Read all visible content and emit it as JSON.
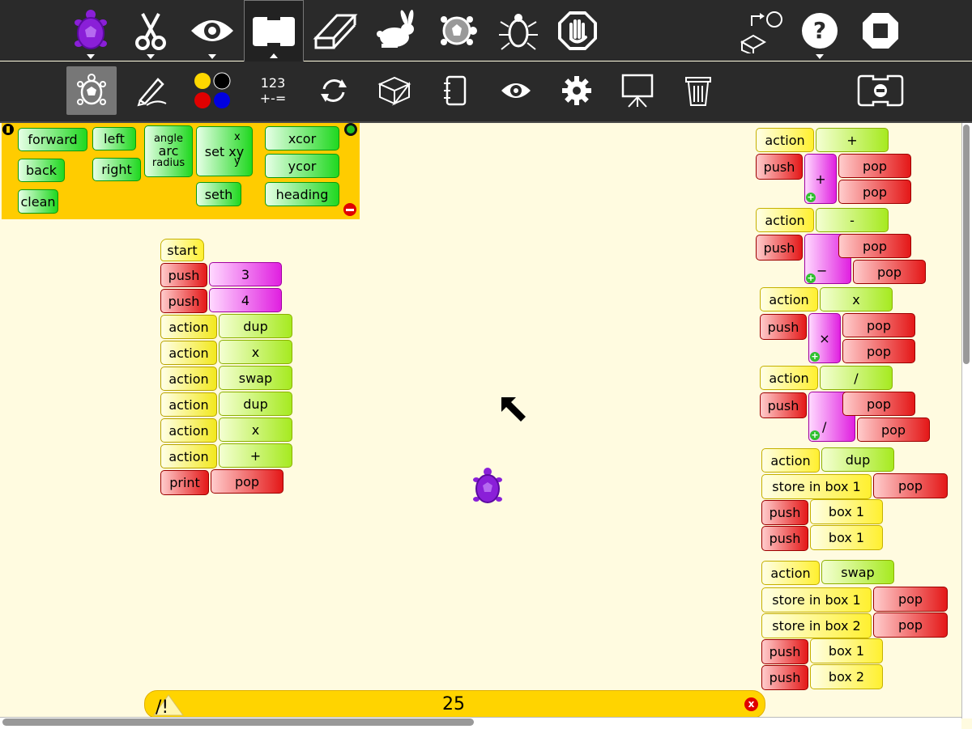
{
  "toolbar_main": {
    "items": [
      {
        "icon": "turtle-palette-icon",
        "caret": "down"
      },
      {
        "icon": "scissors-icon",
        "caret": "down"
      },
      {
        "icon": "eye-icon",
        "caret": "down"
      },
      {
        "icon": "blocks-icon",
        "caret": "up",
        "selected": true
      },
      {
        "icon": "eraser-icon"
      },
      {
        "icon": "rabbit-run-fast-icon"
      },
      {
        "icon": "turtle-run-slow-icon"
      },
      {
        "icon": "bug-debug-icon"
      },
      {
        "icon": "stop-hand-icon"
      },
      {
        "icon": "load-plugin-icon"
      },
      {
        "icon": "help-icon",
        "caret": "down"
      },
      {
        "icon": "stop-activity-icon"
      }
    ]
  },
  "toolbar_palette": {
    "items": [
      {
        "icon": "turtle-palette-icon",
        "selected": true
      },
      {
        "icon": "pen-icon"
      },
      {
        "icon": "colors-icon"
      },
      {
        "icon": "numbers-icon",
        "label_top": "123",
        "label_bottom": "+-="
      },
      {
        "icon": "flow-icon"
      },
      {
        "icon": "boxes-icon"
      },
      {
        "icon": "sensors-icon"
      },
      {
        "icon": "show-icon"
      },
      {
        "icon": "extras-icon"
      },
      {
        "icon": "presentation-icon"
      },
      {
        "icon": "trash-icon"
      },
      {
        "icon": "collapse-blocks-icon"
      }
    ]
  },
  "palette": {
    "background": "#ffcc00",
    "blocks": {
      "forward": "forward",
      "back": "back",
      "clean": "clean",
      "left": "left",
      "right": "right",
      "arc_angle": "angle",
      "arc": "arc",
      "arc_radius": "radius",
      "setxy_x": "x",
      "setxy": "set xy",
      "setxy_y": "y",
      "seth": "seth",
      "xcor": "xcor",
      "ycor": "ycor",
      "heading": "heading"
    }
  },
  "program_stack": [
    {
      "type": "hat",
      "color": "yellow",
      "label": "start"
    },
    {
      "label": "push",
      "color": "red",
      "arg": "3",
      "arg_color": "magenta"
    },
    {
      "label": "push",
      "color": "red",
      "arg": "4",
      "arg_color": "magenta"
    },
    {
      "label": "action",
      "color": "yellow",
      "arg": "dup"
    },
    {
      "label": "action",
      "color": "yellow",
      "arg": "x"
    },
    {
      "label": "action",
      "color": "yellow",
      "arg": "swap"
    },
    {
      "label": "action",
      "color": "yellow",
      "arg": "dup"
    },
    {
      "label": "action",
      "color": "yellow",
      "arg": "x"
    },
    {
      "label": "action",
      "color": "yellow",
      "arg": "+"
    },
    {
      "label": "print",
      "color": "red",
      "arg": "pop",
      "arg_color": "red"
    }
  ],
  "definitions": {
    "plus": {
      "action": "action",
      "name": "+",
      "push": "push",
      "op": "+",
      "a": "pop",
      "b": "pop"
    },
    "minus": {
      "action": "action",
      "name": "-",
      "push": "push",
      "op": "−",
      "a": "pop",
      "b": "pop"
    },
    "times": {
      "action": "action",
      "name": "x",
      "push": "push",
      "op": "×",
      "a": "pop",
      "b": "pop"
    },
    "divide": {
      "action": "action",
      "name": "/",
      "push": "push",
      "op": "/",
      "a": "pop",
      "b": "pop"
    },
    "dup": {
      "action": "action",
      "name": "dup",
      "store": "store in box 1",
      "store_arg": "pop",
      "push1": "push",
      "box_a": "box 1",
      "push2": "push",
      "box_b": "box 1"
    },
    "swap": {
      "action": "action",
      "name": "swap",
      "store1": "store in box 1",
      "store1_arg": "pop",
      "store2": "store in box 2",
      "store2_arg": "pop",
      "push1": "push",
      "box_a": "box 1",
      "push2": "push",
      "box_b": "box 2"
    }
  },
  "status": {
    "icon": "warning-icon",
    "value": "25"
  }
}
